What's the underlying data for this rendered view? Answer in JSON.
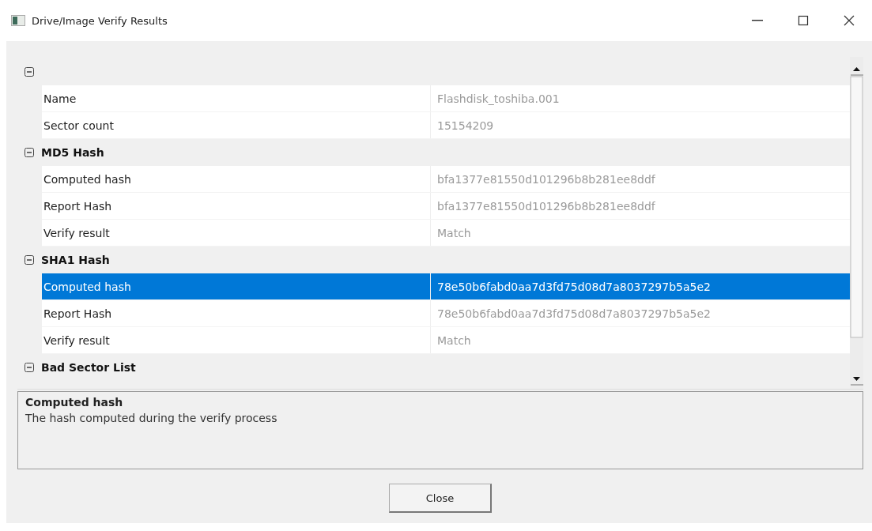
{
  "window": {
    "title": "Drive/Image Verify Results"
  },
  "property_grid": {
    "categories": [
      {
        "expanded": true,
        "properties": [
          {
            "name": "Name",
            "value": "Flashdisk_toshiba.001",
            "selected": false
          },
          {
            "name": "Sector count",
            "value": "15154209",
            "selected": false
          }
        ]
      },
      {
        "label": "MD5 Hash",
        "expanded": true,
        "properties": [
          {
            "name": "Computed hash",
            "value": "bfa1377e81550d101296b8b281ee8ddf",
            "selected": false
          },
          {
            "name": "Report Hash",
            "value": "bfa1377e81550d101296b8b281ee8ddf",
            "selected": false
          },
          {
            "name": "Verify result",
            "value": "Match",
            "selected": false
          }
        ]
      },
      {
        "label": "SHA1 Hash",
        "expanded": true,
        "properties": [
          {
            "name": "Computed hash",
            "value": "78e50b6fabd0aa7d3fd75d08d7a8037297b5a5e2",
            "selected": true
          },
          {
            "name": "Report Hash",
            "value": "78e50b6fabd0aa7d3fd75d08d7a8037297b5a5e2",
            "selected": false
          },
          {
            "name": "Verify result",
            "value": "Match",
            "selected": false
          }
        ]
      },
      {
        "label": "Bad Sector List",
        "expanded": true
      }
    ]
  },
  "description": {
    "title": "Computed hash",
    "text": "The hash computed during the verify process"
  },
  "buttons": [
    {
      "label": "Close"
    }
  ]
}
